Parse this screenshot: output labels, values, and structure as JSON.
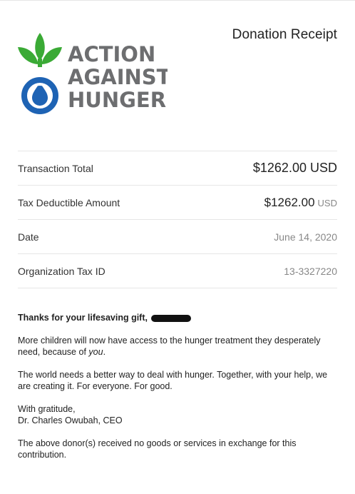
{
  "receipt_title": "Donation Receipt",
  "logo": {
    "line1": "ACTION",
    "line2": "AGAINST",
    "line3": "HUNGER"
  },
  "rows": [
    {
      "label": "Transaction Total",
      "amount": "$1262.00",
      "unit": "USD"
    },
    {
      "label": "Tax Deductible Amount",
      "amount": "$1262.00",
      "unit": "USD"
    },
    {
      "label": "Date",
      "value": "June 14, 2020"
    },
    {
      "label": "Organization Tax ID",
      "value": "13-3327220"
    }
  ],
  "message": {
    "thanks": "Thanks for your lifesaving gift,",
    "p1_text": "More children will now have access to the hunger treatment they desperately need, because of",
    "p1_em": "you",
    "p1_end": ".",
    "p2": "The world needs a better way to deal with hunger. Together, with your help, we are creating it. For everyone. For good.",
    "sign1": "With gratitude,",
    "sign2": "Dr. Charles Owubah, CEO",
    "disclaimer": "The above donor(s) received no goods or services in exchange for this contribution."
  },
  "colors": {
    "green": "#3aaa35",
    "blue": "#1e63b4",
    "text_grey": "#6d6e70"
  }
}
